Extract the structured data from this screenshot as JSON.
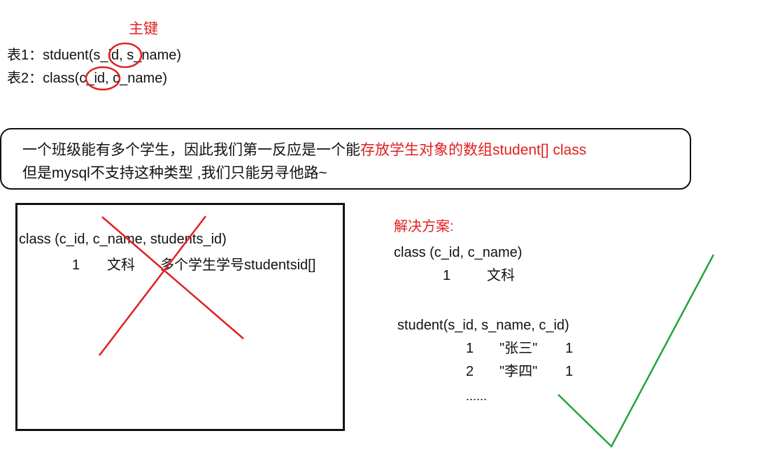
{
  "annotation": {
    "primary_key_label": "主键",
    "color": "#e02020"
  },
  "table1": {
    "prefix": "表1：stduent(",
    "key": "s_id",
    "suffix": ", s_name)"
  },
  "table2": {
    "prefix": "表2：class(",
    "key": "c_id",
    "suffix": ", c_name)"
  },
  "notice": {
    "line1_plain": "一个班级能有多个学生，因此我们第一反应是一个能",
    "line1_red": "存放学生对象的数组student[] class",
    "line2": "但是mysql不支持这种类型 ,我们只能另寻他路~"
  },
  "wrong_design": {
    "schema": "class (c_id, c_name, students_id)",
    "row": {
      "c_id": "1",
      "c_name": "文科",
      "students_id": "多个学生学号studentsid[]"
    },
    "mark": "cross",
    "mark_color": "#e02020"
  },
  "solution": {
    "title": "解决方案:",
    "title_color": "#e02020",
    "class_schema": "class (c_id, c_name)",
    "class_rows": [
      {
        "c_id": "1",
        "c_name": "文科"
      }
    ],
    "student_schema": "student(s_id, s_name, c_id)",
    "student_rows": [
      {
        "s_id": "1",
        "s_name": "\"张三\"",
        "c_id": "1"
      },
      {
        "s_id": "2",
        "s_name": "\"李四\"",
        "c_id": "1"
      }
    ],
    "ellipsis": "......",
    "mark": "check",
    "mark_color": "#22a33a"
  }
}
